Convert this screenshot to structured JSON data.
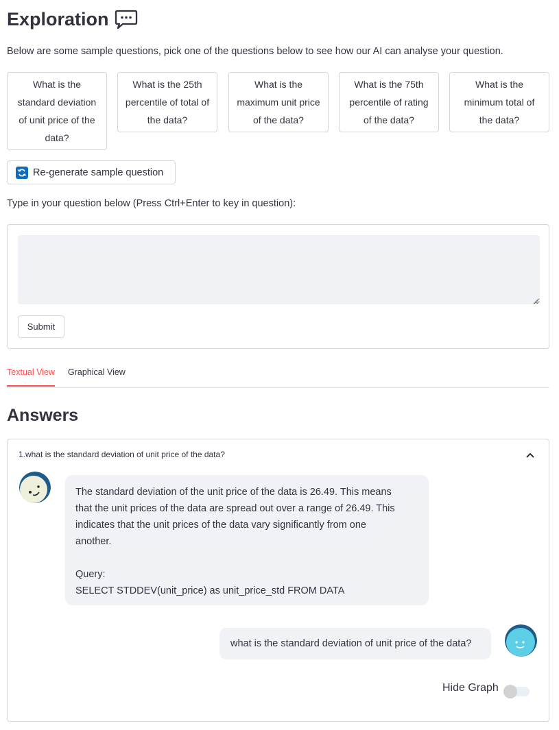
{
  "page": {
    "title": "Exploration",
    "title_icon": "speech-bubble-icon",
    "intro": "Below are some sample questions, pick one of the questions below to see how our AI can analyse your question."
  },
  "sample_questions": [
    "What is the standard deviation of unit price of the data?",
    "What is the 25th percentile of total of the data?",
    "What is the maximum unit price of the data?",
    "What is the 75th percentile of rating of the data?",
    "What is the minimum total of the data?"
  ],
  "regenerate": {
    "label": "Re-generate sample question",
    "icon": "refresh-icon"
  },
  "question_form": {
    "label": "Type in your question below (Press Ctrl+Enter to key in question):",
    "value": "",
    "submit_label": "Submit"
  },
  "tabs": [
    {
      "label": "Textual View",
      "active": true
    },
    {
      "label": "Graphical View",
      "active": false
    }
  ],
  "answers": {
    "heading": "Answers",
    "items": [
      {
        "header": "1.what is the standard deviation of unit price of the data?",
        "bot_lines": [
          "The standard deviation of the unit price of the data is 26.49. This means",
          "that the unit prices of the data are spread out over a range of 26.49. This",
          "indicates that the unit prices of the data vary significantly from one",
          "another."
        ],
        "query_label": "Query:",
        "query": "SELECT STDDEV(unit_price) as unit_price_std FROM DATA",
        "user_message": "what is the standard deviation of unit price of the data?",
        "toggle_label": "Hide Graph",
        "toggle_on": false
      }
    ]
  },
  "colors": {
    "accent": "#ff4b4b",
    "bubble": "#f0f2f6",
    "border": "#d6d6d9",
    "text": "#31333f"
  }
}
